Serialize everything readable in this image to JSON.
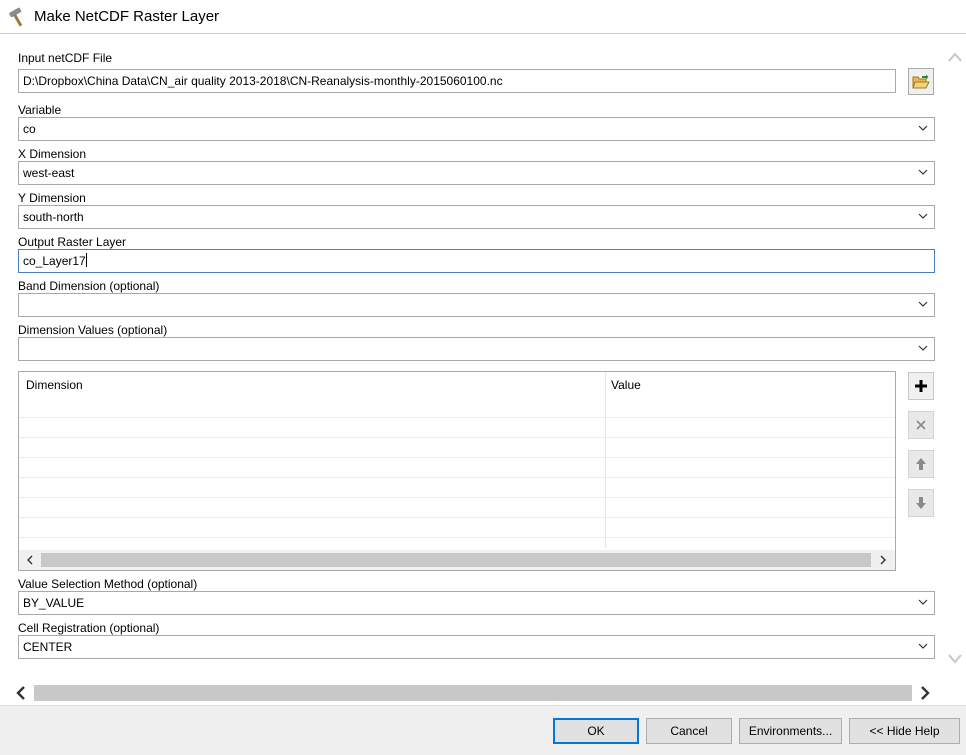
{
  "window": {
    "title": "Make NetCDF Raster Layer",
    "icon": "hammer-icon"
  },
  "form": {
    "input_file": {
      "label": "Input netCDF File",
      "value": "D:\\Dropbox\\China Data\\CN_air quality 2013-2018\\CN-Reanalysis-monthly-2015060100.nc"
    },
    "variable": {
      "label": "Variable",
      "value": "co"
    },
    "x_dimension": {
      "label": "X Dimension",
      "value": "west-east"
    },
    "y_dimension": {
      "label": "Y Dimension",
      "value": "south-north"
    },
    "output_layer": {
      "label": "Output Raster Layer",
      "value": "co_Layer17"
    },
    "band_dimension": {
      "label": "Band Dimension (optional)",
      "value": ""
    },
    "dimension_values": {
      "label": "Dimension Values (optional)",
      "value": "",
      "table": {
        "columns": [
          "Dimension",
          "Value"
        ],
        "rows": []
      }
    },
    "value_selection_method": {
      "label": "Value Selection Method (optional)",
      "value": "BY_VALUE"
    },
    "cell_registration": {
      "label": "Cell Registration (optional)",
      "value": "CENTER"
    }
  },
  "buttons": {
    "ok": "OK",
    "cancel": "Cancel",
    "environments": "Environments...",
    "hide_help": "<< Hide Help"
  },
  "colors": {
    "focus_border": "#4a7fc1",
    "default_button_border": "#0078d7",
    "footer_bg": "#f0f0f0",
    "folder_icon": "#e8b84a"
  }
}
